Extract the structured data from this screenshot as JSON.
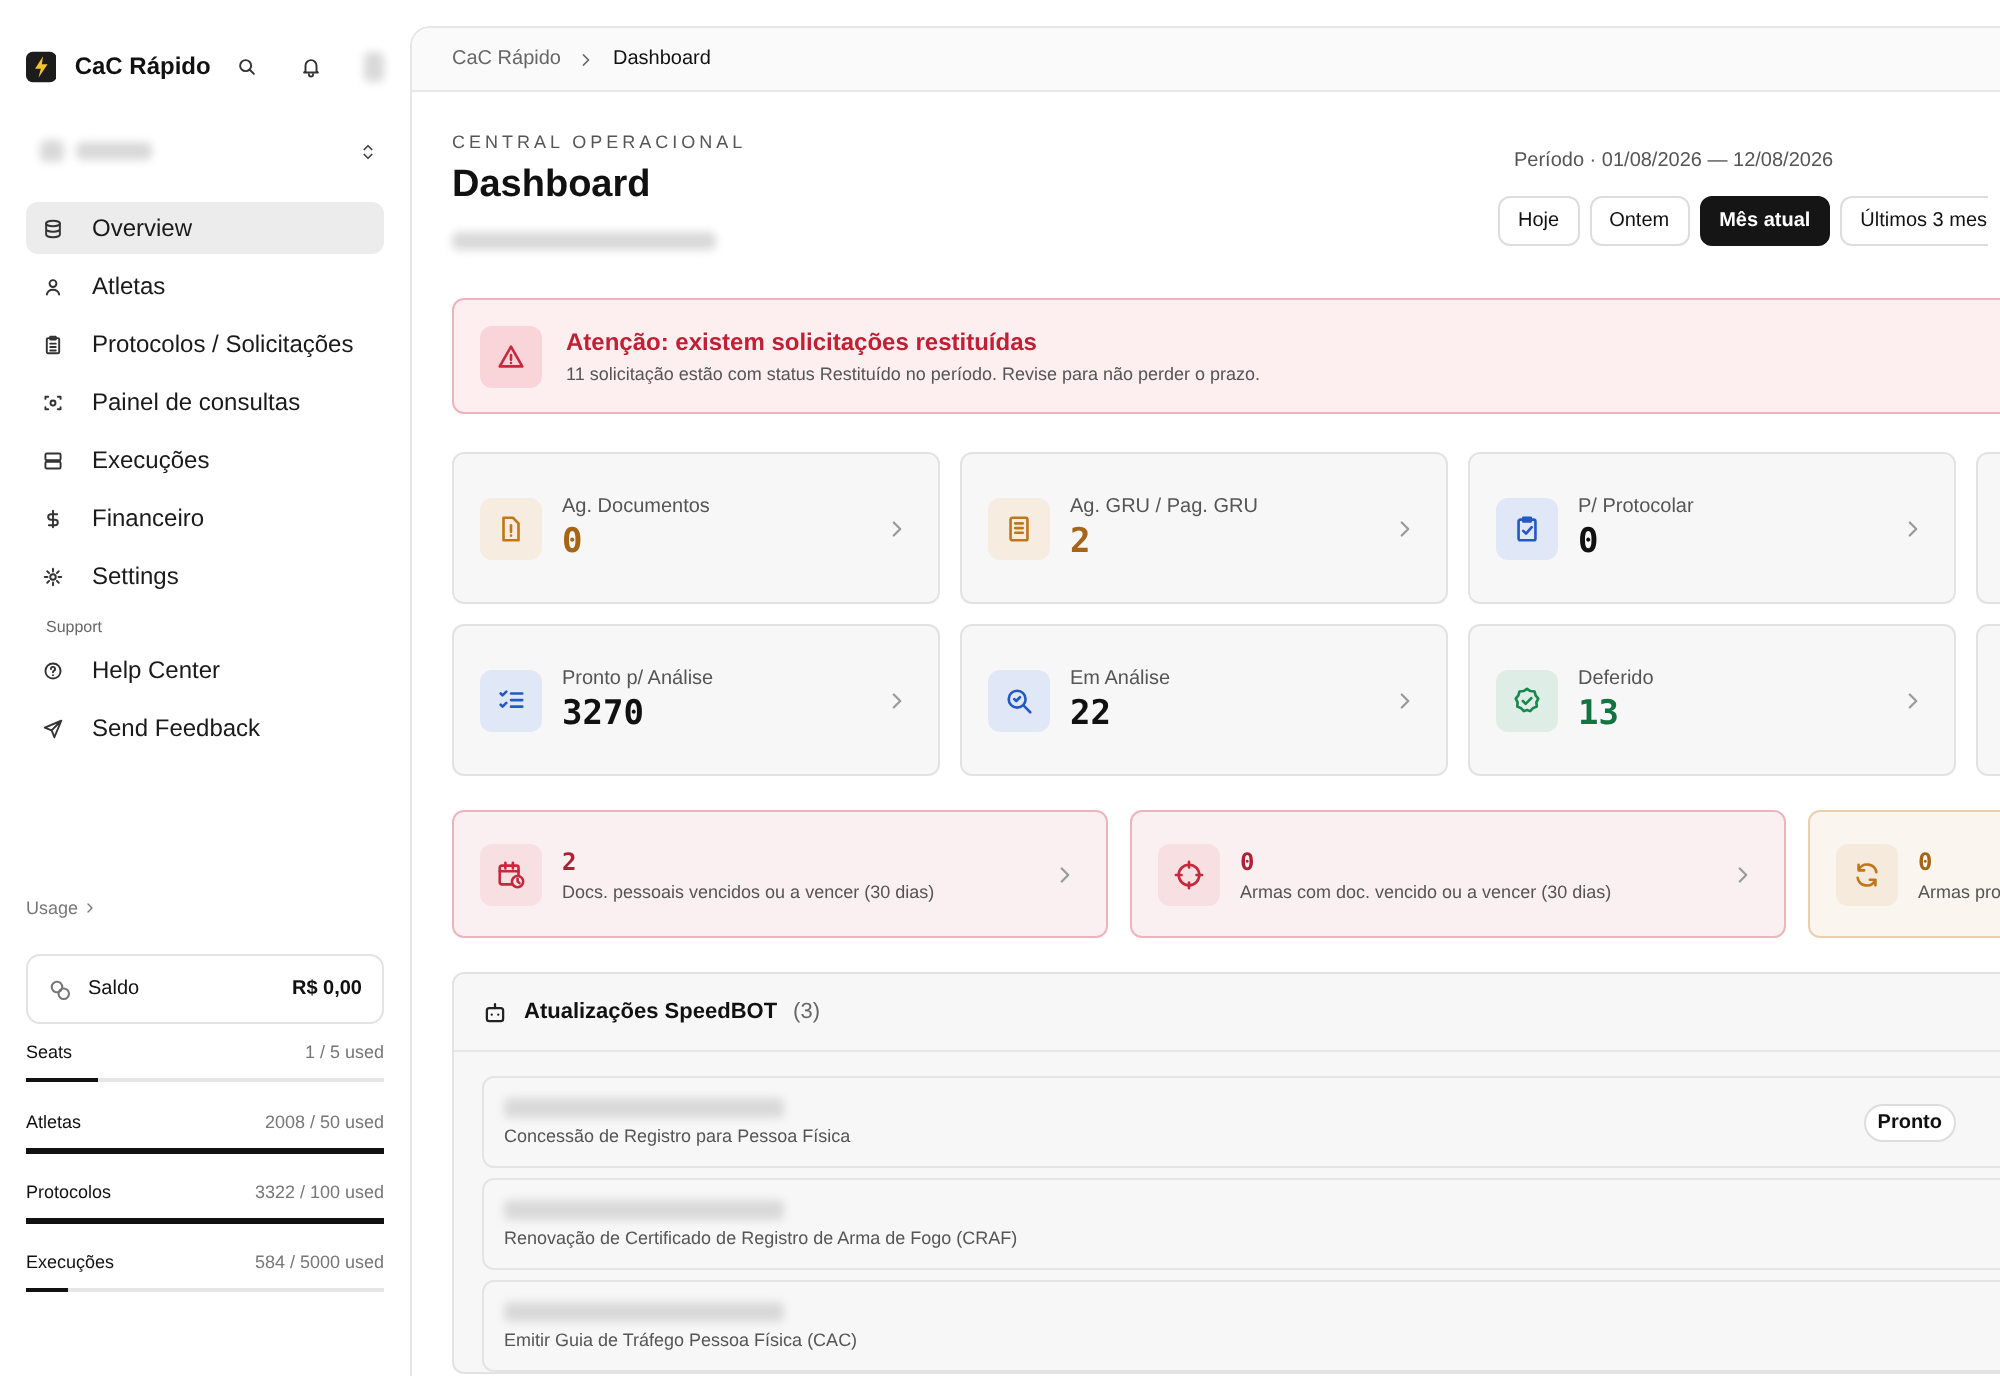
{
  "sidebar": {
    "app_name": "CaC Rápido",
    "nav": [
      {
        "label": "Overview",
        "selected": true
      },
      {
        "label": "Atletas",
        "selected": false
      },
      {
        "label": "Protocolos / Solicitações",
        "selected": false
      },
      {
        "label": "Painel de consultas",
        "selected": false
      },
      {
        "label": "Execuções",
        "selected": false
      },
      {
        "label": "Financeiro",
        "selected": false
      },
      {
        "label": "Settings",
        "selected": false
      }
    ],
    "support_label": "Support",
    "support": [
      {
        "label": "Help Center"
      },
      {
        "label": "Send Feedback"
      }
    ],
    "usage_label": "Usage",
    "balance": {
      "label": "Saldo",
      "value": "R$ 0,00"
    },
    "meters": [
      {
        "name": "Seats",
        "reading": "1 / 5 used",
        "level": 0.2
      },
      {
        "name": "Atletas",
        "reading": "2008 / 50 used",
        "level": 1
      },
      {
        "name": "Protocolos",
        "reading": "3322 / 100 used",
        "level": 1
      },
      {
        "name": "Execuções",
        "reading": "584 / 5000 used",
        "level": 0.12
      }
    ]
  },
  "breadcrumb": [
    "CaC Rápido",
    "Dashboard"
  ],
  "header": {
    "eyebrow": "CENTRAL OPERACIONAL",
    "title": "Dashboard",
    "period": "Período · 01/08/2026 — 12/08/2026",
    "ranges": [
      {
        "label": "Hoje",
        "selected": false
      },
      {
        "label": "Ontem",
        "selected": false
      },
      {
        "label": "Mês atual",
        "selected": true
      },
      {
        "label": "Últimos 3 mes",
        "selected": false
      }
    ]
  },
  "alert": {
    "title": "Atenção: existem solicitações restituídas",
    "message": "11 solicitação estão com status Restituído no período. Revise para não perder o prazo."
  },
  "stats": [
    {
      "label": "Ag. Documentos",
      "value": "0",
      "color": "#c2761b"
    },
    {
      "label": "Ag. GRU / Pag. GRU",
      "value": "2",
      "color": "#c2761b"
    },
    {
      "label": "P/ Protocolar",
      "value": "0",
      "color": "#2459c4"
    },
    {
      "label": "Pronto p/ Análise",
      "value": "3270",
      "color": "#2459c4"
    },
    {
      "label": "Em Análise",
      "value": "22",
      "color": "#2459c4"
    },
    {
      "label": "Deferido",
      "value": "13",
      "color": "#16874d"
    }
  ],
  "expiry_cards": [
    {
      "value": "2",
      "label": "Docs. pessoais vencidos ou a vencer (30 dias)",
      "color": "#c8283c"
    },
    {
      "value": "0",
      "label": "Armas com doc. vencido ou a vencer (30 dias)",
      "color": "#c8283c"
    },
    {
      "value": "0",
      "label": "Armas pro",
      "color": "#c2761b"
    }
  ],
  "updates": {
    "title": "Atualizações SpeedBOT",
    "count": "(3)",
    "items": [
      {
        "service": "Concessão de Registro para Pessoa Física",
        "status": "Pronto"
      },
      {
        "service": "Renovação de Certificado de Registro de Arma de Fogo (CRAF)"
      },
      {
        "service": "Emitir Guia de Tráfego Pessoa Física (CAC)"
      }
    ]
  }
}
